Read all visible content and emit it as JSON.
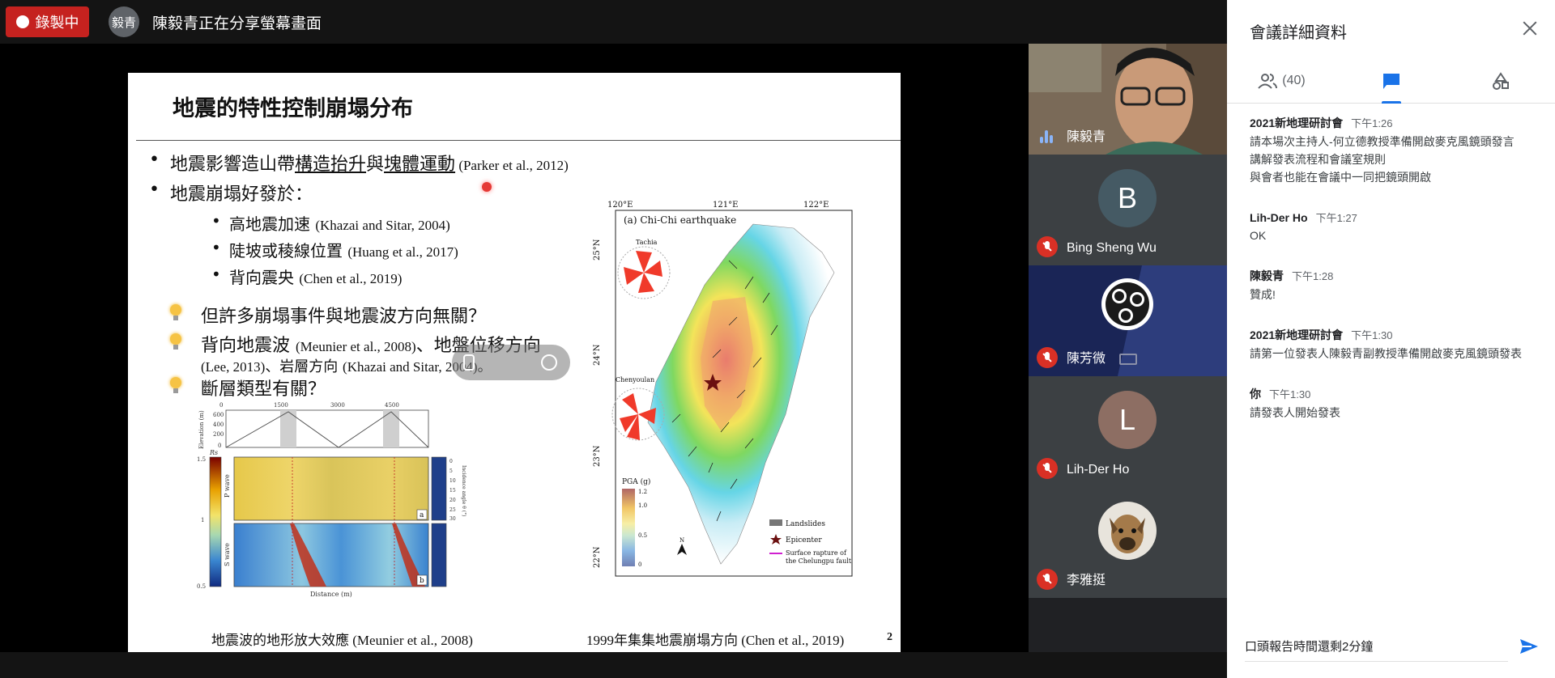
{
  "topbar": {
    "recording_label": "錄製中",
    "presenter_initials": "毅青",
    "presenter_text": "陳毅青正在分享螢幕畫面"
  },
  "slide": {
    "title": "地震的特性控制崩塌分布",
    "bullet1": {
      "pre": "地震影響造山帶",
      "u1": "構造抬升",
      "mid": "與",
      "u2": "塊體運動",
      "ref": " (Parker et al., 2012)"
    },
    "bullet2": "地震崩塌好發於：",
    "sub_bullets": [
      {
        "text": "高地震加速 ",
        "ref": "(Khazai and Sitar, 2004)"
      },
      {
        "text": "陡坡或稜線位置 ",
        "ref": "(Huang et al., 2017)"
      },
      {
        "text": "背向震央 ",
        "ref": "(Chen et al., 2019)"
      }
    ],
    "questions": [
      {
        "text": "但許多崩塌事件與地震波方向無關？"
      },
      {
        "text": "背向地震波 ",
        "ref": "(Meunier et al., 2008)",
        "text2": "、地盤位移方向"
      },
      {
        "text": "斷層類型有關？"
      }
    ],
    "question2_line2": {
      "ref1": "(Lee, 2013)",
      "text": "、岩層方向 ",
      "ref2": "(Khazai and Sitar, 2004)",
      "end": "。"
    },
    "caption_left": "地震波的地形放大效應 (Meunier et al., 2008)",
    "caption_right": "1999年集集地震崩塌方向 (Chen et al., 2019)",
    "page_number": "2",
    "left_figure": {
      "top_axis": [
        "0",
        "1500",
        "3000",
        "4500"
      ],
      "y_top": [
        "600",
        "400",
        "200",
        "0"
      ],
      "y_top_label": "Elevation (m)",
      "rs_label": "Rs",
      "colorbar": [
        "1.5",
        "1",
        "0.5"
      ],
      "p_label": "P wave",
      "s_label": "S wave",
      "panel_a": "a",
      "panel_b": "b",
      "x_label": "Distance (m)",
      "right_ticks": [
        "0",
        "5",
        "10",
        "15",
        "20",
        "25",
        "30"
      ],
      "right_axis_label": "Incidence angle θ (°)"
    },
    "right_figure": {
      "title": "(a) Chi-Chi earthquake",
      "lon_ticks": [
        "120°E",
        "121°E",
        "122°E"
      ],
      "lat_ticks": [
        "25°N",
        "24°N",
        "23°N",
        "22°N"
      ],
      "rose1": "Tachia",
      "rose2": "Chenyoulan",
      "pga_label": "PGA (g)",
      "pga_ticks": [
        "1.2",
        "1.0",
        "0.5",
        "0"
      ],
      "legend": [
        "Landslides",
        "Epicenter",
        "Surface rapture of",
        "the Chelungpu fault"
      ],
      "north": "N"
    }
  },
  "tiles": [
    {
      "name": "陳毅青",
      "type": "video",
      "speaking": true
    },
    {
      "name": "Bing Sheng Wu",
      "initial": "B",
      "avatar_color": "#455a64",
      "muted": true
    },
    {
      "name": "陳芳微",
      "type": "logo",
      "muted": true,
      "camera_off": true
    },
    {
      "name": "Lih-Der Ho",
      "initial": "L",
      "avatar_color": "#8d6e63",
      "muted": true
    },
    {
      "name": "李雅挺",
      "type": "dog",
      "muted": true
    }
  ],
  "panel": {
    "title": "會議詳細資料",
    "people_count": "(40)",
    "messages": [
      {
        "sender": "2021新地理研討會",
        "time": "下午1:26",
        "lines": [
          "請本場次主持人-何立德教授準備開啟麥克風鏡頭發言",
          "講解發表流程和會議室規則",
          "與會者也能在會議中一同把鏡頭開啟"
        ]
      },
      {
        "sender": "Lih-Der Ho",
        "time": "下午1:27",
        "lines": [
          "OK"
        ]
      },
      {
        "sender": "陳毅青",
        "time": "下午1:28",
        "lines": [
          "贊成!"
        ]
      },
      {
        "sender": "2021新地理研討會",
        "time": "下午1:30",
        "lines": [
          "請第一位發表人陳毅青副教授準備開啟麥克風鏡頭發表"
        ]
      },
      {
        "sender": "你",
        "time": "下午1:30",
        "lines": [
          "請發表人開始發表"
        ]
      }
    ],
    "composer_value": "口頭報告時間還剩2分鐘"
  },
  "colors": {
    "record": "#c5221f",
    "accent": "#1a73e8",
    "muted": "#d93025"
  }
}
